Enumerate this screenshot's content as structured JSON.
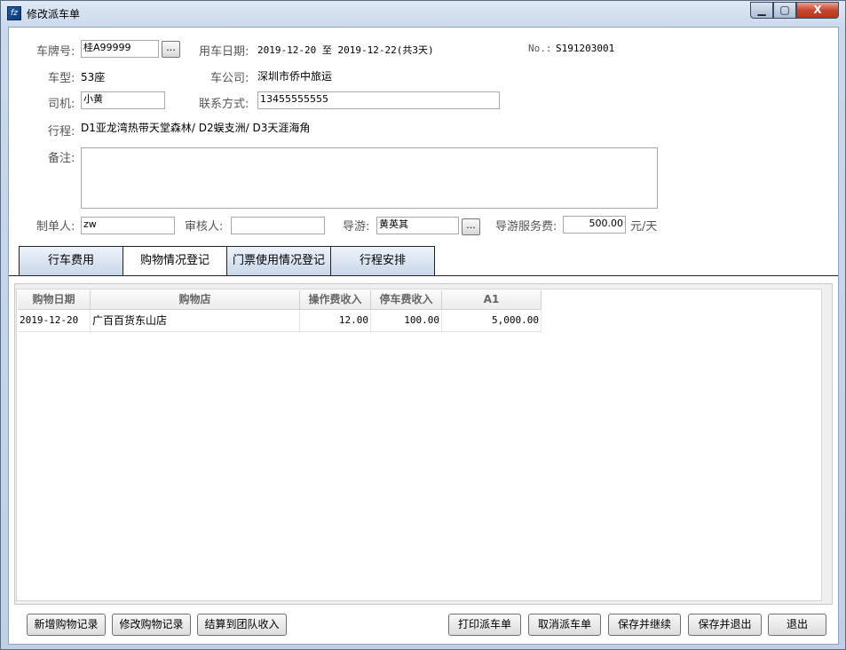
{
  "window": {
    "title": "修改派车单",
    "icon": "app-icon",
    "icon_glyph": "fz",
    "min_glyph": "▁",
    "max_glyph": "▢",
    "close_glyph": "X"
  },
  "form": {
    "plate_label": "车牌号:",
    "plate_value": "桂A99999",
    "browse_label": "...",
    "date_label": "用车日期:",
    "date_value": "2019-12-20 至 2019-12-22(共3天)",
    "no_label": "No.:",
    "no_value": "S191203001",
    "type_label": "车型:",
    "type_value": "53座",
    "company_label": "车公司:",
    "company_value": "深圳市侨中旅运",
    "driver_label": "司机:",
    "driver_value": "小黄",
    "contact_label": "联系方式:",
    "contact_value": "13455555555",
    "route_label": "行程:",
    "route_value": "D1亚龙湾热带天堂森林/ D2蜈支洲/ D3天涯海角",
    "remark_label": "备注:",
    "remark_value": "",
    "maker_label": "制单人:",
    "maker_value": "zw",
    "reviewer_label": "审核人:",
    "reviewer_value": "",
    "guide_label": "导游:",
    "guide_value": "黄英其",
    "fee_label": "导游服务费:",
    "fee_value": "500.00",
    "fee_unit": "元/天"
  },
  "tabs": [
    {
      "label": "行车费用",
      "active": false
    },
    {
      "label": "购物情况登记",
      "active": true
    },
    {
      "label": "门票使用情况登记",
      "active": false
    },
    {
      "label": "行程安排",
      "active": false
    }
  ],
  "table": {
    "headers": [
      "购物日期",
      "购物店",
      "操作费收入",
      "停车费收入",
      "A1"
    ],
    "rows": [
      [
        "2019-12-20",
        "广百百货东山店",
        "12.00",
        "100.00",
        "5,000.00"
      ]
    ]
  },
  "buttons": {
    "add": "新增购物记录",
    "edit": "修改购物记录",
    "settle": "结算到团队收入",
    "print": "打印派车单",
    "cancel": "取消派车单",
    "save_continue": "保存并继续",
    "save_exit": "保存并退出",
    "exit": "退出"
  }
}
